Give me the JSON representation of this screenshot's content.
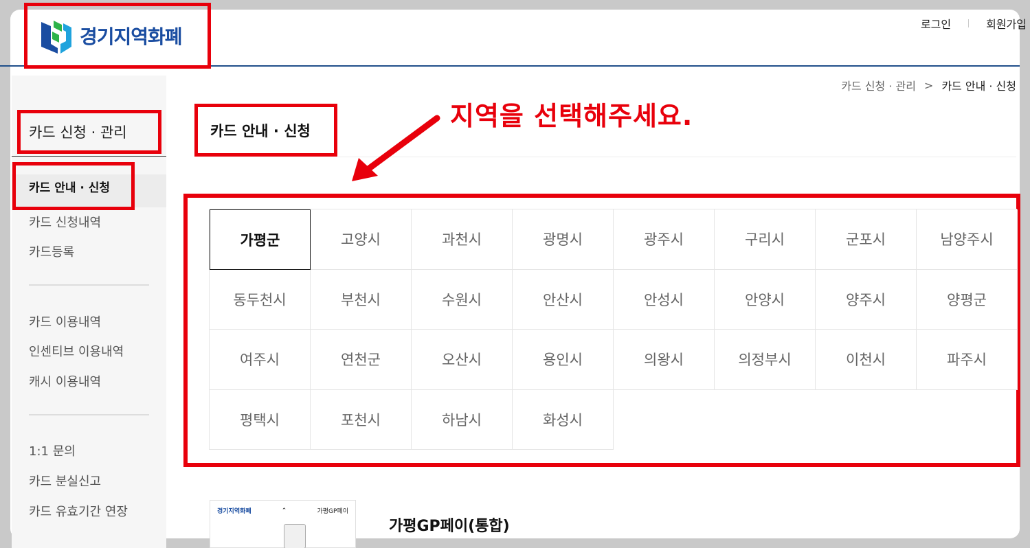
{
  "header": {
    "logo_text": "경기지역화폐",
    "login": "로그인",
    "signup": "회원가입"
  },
  "sidebar": {
    "title": "카드 신청 · 관리",
    "active_item": "카드 안내 · 신청",
    "group1": [
      "카드 신청내역",
      "카드등록"
    ],
    "group2": [
      "카드 이용내역",
      "인센티브 이용내역",
      "캐시 이용내역"
    ],
    "group3": [
      "1:1 문의",
      "카드 분실신고",
      "카드 유효기간 연장"
    ]
  },
  "breadcrumb": {
    "parent": "카드 신청 · 관리",
    "separator": ">",
    "current": "카드 안내 · 신청"
  },
  "page": {
    "title": "카드 안내 · 신청",
    "annotation": "지역을 선택해주세요."
  },
  "regions": {
    "selected": "가평군",
    "items": [
      "가평군",
      "고양시",
      "과천시",
      "광명시",
      "광주시",
      "구리시",
      "군포시",
      "남양주시",
      "동두천시",
      "부천시",
      "수원시",
      "안산시",
      "안성시",
      "안양시",
      "양주시",
      "양평군",
      "여주시",
      "연천군",
      "오산시",
      "용인시",
      "의왕시",
      "의정부시",
      "이천시",
      "파주시",
      "평택시",
      "포천시",
      "하남시",
      "화성시"
    ]
  },
  "card": {
    "thumb_logo": "경기지역화폐",
    "thumb_label": "가평GP페이",
    "name": "가평GP페이(통합)"
  },
  "colors": {
    "highlight": "#e8000b",
    "brand": "#1a4da1",
    "header_line": "#1f4e8a"
  }
}
